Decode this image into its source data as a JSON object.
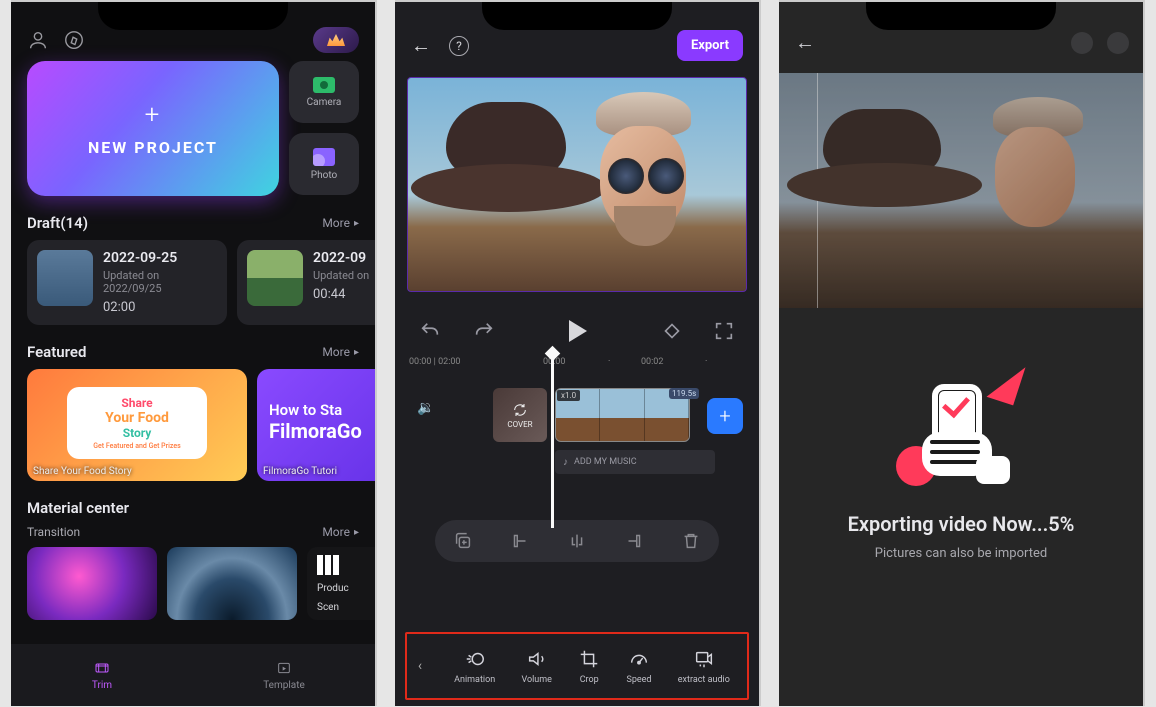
{
  "screen1": {
    "new_project_label": "NEW PROJECT",
    "camera_label": "Camera",
    "photo_label": "Photo",
    "draft_heading": "Draft(14)",
    "more_label": "More",
    "drafts": [
      {
        "title": "2022-09-25",
        "subtitle": "Updated on 2022/09/25",
        "duration": "02:00"
      },
      {
        "title": "2022-09",
        "subtitle": "Updated on",
        "duration": "00:44"
      }
    ],
    "featured_heading": "Featured",
    "feat1": {
      "line1": "Share",
      "line2": "Your Food",
      "line3": "Story",
      "sub": "Get Featured and Get Prizes",
      "caption": "Share Your Food Story"
    },
    "feat2": {
      "line1": "How to Sta",
      "line2": "FilmoraGo",
      "caption": "FilmoraGo Tutori"
    },
    "material_heading": "Material center",
    "transition_sub": "Transition",
    "trans3_caption1": "Produc",
    "trans3_caption2": "Scen",
    "nav": {
      "trim": "Trim",
      "template": "Template"
    }
  },
  "screen2": {
    "export_label": "Export",
    "time_labels": {
      "t0": "00:00 | 02:00",
      "t1": "00:00",
      "t2": "00:02"
    },
    "cover_label": "COVER",
    "clip_speed": "x1.0",
    "clip_duration": "119.5s",
    "music_label": "ADD MY MUSIC",
    "tools": {
      "animation": "Animation",
      "volume": "Volume",
      "crop": "Crop",
      "speed": "Speed",
      "extract": "extract audio"
    }
  },
  "screen3": {
    "title": "Exporting video Now...5%",
    "subtitle": "Pictures can also be imported"
  }
}
